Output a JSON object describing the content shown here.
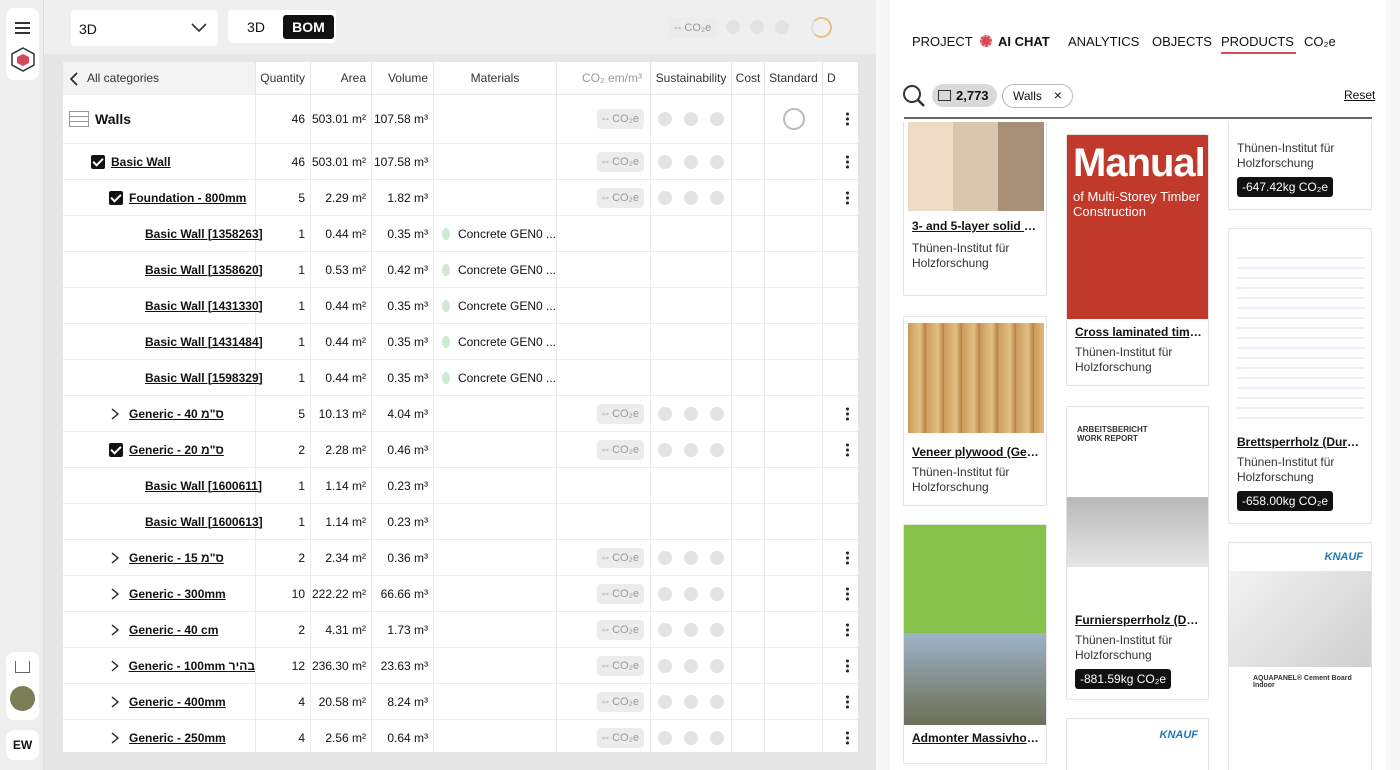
{
  "nav": {
    "user_initials": "EW"
  },
  "toolbar": {
    "view_select": "3D",
    "seg_3d": "3D",
    "seg_bom": "BOM",
    "co2_pill": "-- CO₂e"
  },
  "table": {
    "back_label": "All categories",
    "headers": {
      "quantity": "Quantity",
      "area": "Area",
      "volume": "Volume",
      "materials": "Materials",
      "co2": "CO₂ em/m³",
      "sustainability": "Sustainability",
      "cost": "Cost",
      "standard": "Standard",
      "d": "D"
    },
    "rows": [
      {
        "level": 0,
        "label": "Walls",
        "qty": "46",
        "area": "503.01 m²",
        "vol": "107.58 m³",
        "mat": "",
        "co2": "-- CO₂e"
      },
      {
        "level": 1,
        "label": "Basic Wall",
        "qty": "46",
        "area": "503.01 m²",
        "vol": "107.58 m³",
        "mat": "",
        "co2": "-- CO₂e",
        "check": true
      },
      {
        "level": 2,
        "label": "Foundation - 800mm",
        "qty": "5",
        "area": "2.29 m²",
        "vol": "1.82 m³",
        "mat": "",
        "co2": "-- CO₂e",
        "check": true
      },
      {
        "level": 3,
        "label": "Basic Wall [1358263]",
        "qty": "1",
        "area": "0.44 m²",
        "vol": "0.35 m³",
        "mat": "Concrete GEN0 ..."
      },
      {
        "level": 3,
        "label": "Basic Wall [1358620]",
        "qty": "1",
        "area": "0.53 m²",
        "vol": "0.42 m³",
        "mat": "Concrete GEN0 ..."
      },
      {
        "level": 3,
        "label": "Basic Wall [1431330]",
        "qty": "1",
        "area": "0.44 m²",
        "vol": "0.35 m³",
        "mat": "Concrete GEN0 ..."
      },
      {
        "level": 3,
        "label": "Basic Wall [1431484]",
        "qty": "1",
        "area": "0.44 m²",
        "vol": "0.35 m³",
        "mat": "Concrete GEN0 ..."
      },
      {
        "level": 3,
        "label": "Basic Wall [1598329]",
        "qty": "1",
        "area": "0.44 m²",
        "vol": "0.35 m³",
        "mat": "Concrete GEN0 ..."
      },
      {
        "level": 2,
        "label": "Generic - 40 ס\"מ",
        "qty": "5",
        "area": "10.13 m²",
        "vol": "4.04 m³",
        "mat": "",
        "co2": "-- CO₂e",
        "expand": true
      },
      {
        "level": 2,
        "label": "Generic - 20 ס\"מ",
        "qty": "2",
        "area": "2.28 m²",
        "vol": "0.46 m³",
        "mat": "",
        "co2": "-- CO₂e",
        "check": true
      },
      {
        "level": 3,
        "label": "Basic Wall [1600611]",
        "qty": "1",
        "area": "1.14 m²",
        "vol": "0.23 m³",
        "mat": ""
      },
      {
        "level": 3,
        "label": "Basic Wall [1600613]",
        "qty": "1",
        "area": "1.14 m²",
        "vol": "0.23 m³",
        "mat": ""
      },
      {
        "level": 2,
        "label": "Generic - 15 ס\"מ",
        "qty": "2",
        "area": "2.34 m²",
        "vol": "0.36 m³",
        "mat": "",
        "co2": "-- CO₂e",
        "expand": true
      },
      {
        "level": 2,
        "label": "Generic - 300mm",
        "qty": "10",
        "area": "222.22 m²",
        "vol": "66.66 m³",
        "mat": "",
        "co2": "-- CO₂e",
        "expand": true
      },
      {
        "level": 2,
        "label": "Generic - 40 cm",
        "qty": "2",
        "area": "4.31 m²",
        "vol": "1.73 m³",
        "mat": "",
        "co2": "-- CO₂e",
        "expand": true
      },
      {
        "level": 2,
        "label": "Generic - 100mm בהיר",
        "qty": "12",
        "area": "236.30 m²",
        "vol": "23.63 m³",
        "mat": "",
        "co2": "-- CO₂e",
        "expand": true
      },
      {
        "level": 2,
        "label": "Generic - 400mm",
        "qty": "4",
        "area": "20.58 m²",
        "vol": "8.24 m³",
        "mat": "",
        "co2": "-- CO₂e",
        "expand": true
      },
      {
        "level": 2,
        "label": "Generic - 250mm",
        "qty": "4",
        "area": "2.56 m²",
        "vol": "0.64 m³",
        "mat": "",
        "co2": "-- CO₂e",
        "expand": true
      }
    ]
  },
  "panel": {
    "tabs": [
      "PROJECT",
      "AI CHAT",
      "ANALYTICS",
      "OBJECTS",
      "PRODUCTS",
      "CO₂e"
    ],
    "count": "2,773",
    "filter_chip": "Walls",
    "reset": "Reset",
    "cards": [
      {
        "title": "3- and 5-layer solid wo...",
        "sub": "Thünen-Institut für Holzforschung"
      },
      {
        "title": "Cross laminated timbe...",
        "sub": "Thünen-Institut für Holzforschung",
        "cover_title": "Manual",
        "cover_sub": "of Multi-Storey Timber Construction"
      },
      {
        "title": "",
        "sub": "Thünen-Institut für Holzforschung",
        "badge": "-647.42kg CO₂e"
      },
      {
        "title": "Veneer plywood (Ger...",
        "sub": "Thünen-Institut für Holzforschung"
      },
      {
        "title": "Furniersperrholz (Durc...",
        "sub": "Thünen-Institut für Holzforschung",
        "badge": "-881.59kg CO₂e",
        "cover_title": "ARBEITSBERICHT WORK REPORT"
      },
      {
        "title": "Brettsperrholz (Durch...",
        "sub": "Thünen-Institut für Holzforschung",
        "badge": "-658.00kg CO₂e"
      },
      {
        "title": "Admonter Massivholz...",
        "sub": ""
      },
      {
        "title": "",
        "sub": "",
        "cover_title": "AQUAPANEL® Cement Board Indoor",
        "brand": "KNAUF"
      },
      {
        "title": "",
        "sub": "",
        "brand": "KNAUF"
      }
    ]
  }
}
